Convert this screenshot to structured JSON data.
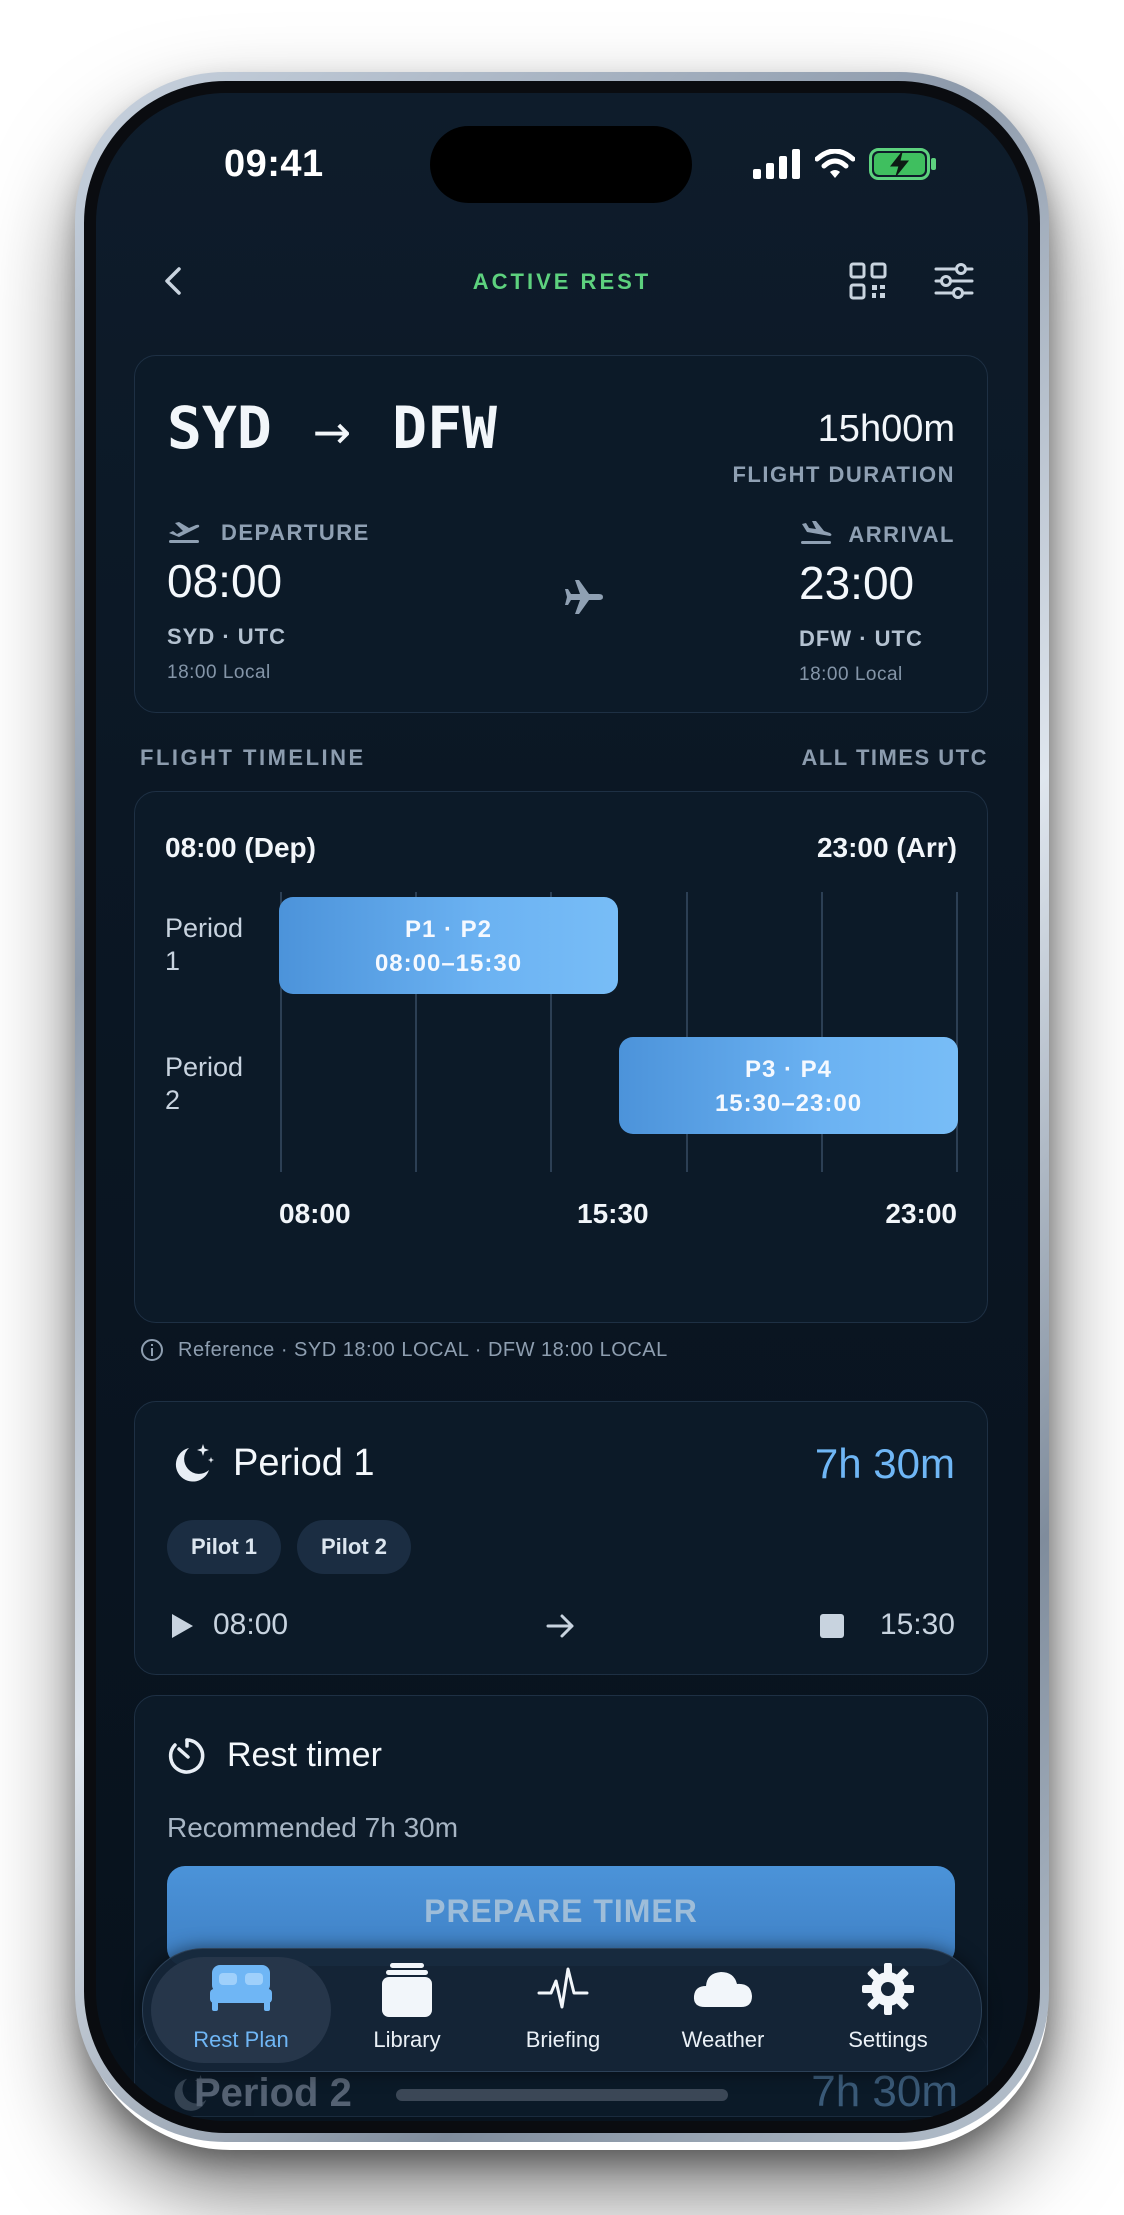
{
  "status_bar": {
    "time": "09:41"
  },
  "header": {
    "title": "ACTIVE REST"
  },
  "route": {
    "origin": "SYD",
    "destination": "DFW",
    "duration": "15h00m",
    "duration_label": "FLIGHT DURATION",
    "departure": {
      "label": "DEPARTURE",
      "time": "08:00",
      "code": "SYD · UTC",
      "local": "18:00 Local"
    },
    "arrival": {
      "label": "ARRIVAL",
      "time": "23:00",
      "code": "DFW · UTC",
      "local": "18:00 Local"
    }
  },
  "timeline": {
    "section_title": "FLIGHT TIMELINE",
    "section_note": "ALL TIMES UTC",
    "start_label": "08:00 (Dep)",
    "end_label": "23:00 (Arr)",
    "rows": [
      {
        "label_line1": "Period",
        "label_line2": "1",
        "bar_title": "P1 · P2",
        "bar_range": "08:00–15:30",
        "start": "08:00",
        "end": "15:30"
      },
      {
        "label_line1": "Period",
        "label_line2": "2",
        "bar_title": "P3 · P4",
        "bar_range": "15:30–23:00",
        "start": "15:30",
        "end": "23:00"
      }
    ],
    "ticks": [
      "08:00",
      "15:30",
      "23:00"
    ],
    "reference": "Reference · SYD 18:00 LOCAL · DFW 18:00 LOCAL"
  },
  "period1": {
    "title": "Period 1",
    "duration": "7h 30m",
    "chips": [
      "Pilot 1",
      "Pilot 2"
    ],
    "start": "08:00",
    "end": "15:30"
  },
  "rest_timer": {
    "title": "Rest timer",
    "recommended": "Recommended 7h 30m",
    "button": "PREPARE TIMER"
  },
  "period2_peek": {
    "title": "Period 2",
    "duration": "7h 30m"
  },
  "tabbar": {
    "tabs": [
      {
        "label": "Rest Plan",
        "icon": "bed-icon",
        "active": true
      },
      {
        "label": "Library",
        "icon": "library-icon",
        "active": false
      },
      {
        "label": "Briefing",
        "icon": "pulse-icon",
        "active": false
      },
      {
        "label": "Weather",
        "icon": "cloud-icon",
        "active": false
      },
      {
        "label": "Settings",
        "icon": "gear-icon",
        "active": false
      }
    ]
  },
  "colors": {
    "accent_green": "#5dd17e",
    "accent_blue": "#6fb6f5",
    "background": "#0b1724"
  }
}
